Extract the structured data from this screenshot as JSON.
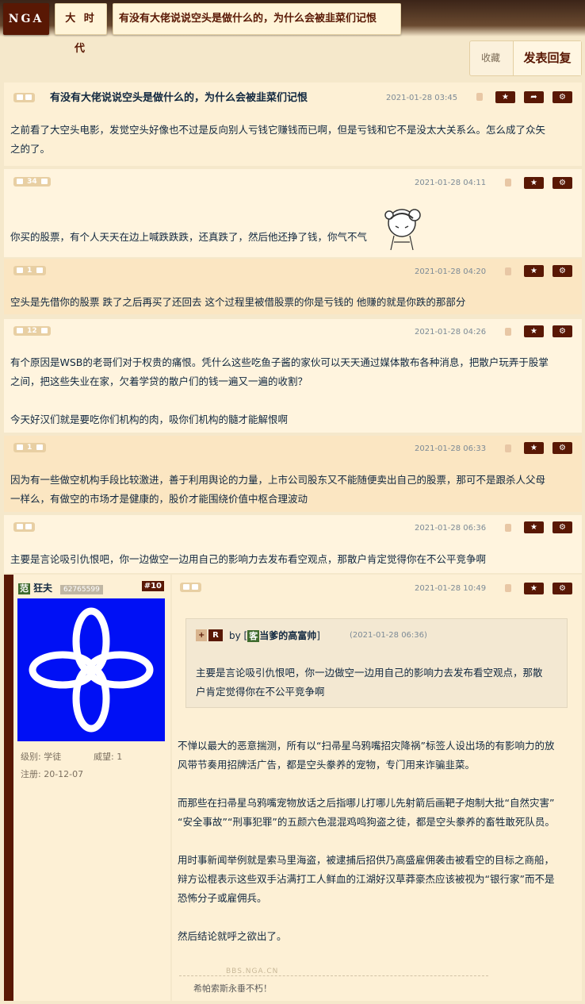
{
  "header": {
    "logo": "NGA",
    "forum": "大 时 代",
    "topic": "有没有大佬说说空头是做什么的，为什么会被韭菜们记恨"
  },
  "actions": {
    "favorite": "收藏",
    "reply": "发表回复"
  },
  "posts": [
    {
      "title": "有没有大佬说说空头是做什么的，为什么会被韭菜们记恨",
      "votes": "",
      "time": "2021-01-28 03:45",
      "lines": [
        "之前看了大空头电影，发觉空头好像也不过是反向别人亏钱它赚钱而已啊，但是亏钱和它不是没太大关系么。怎么成了众矢",
        "之的了。"
      ]
    },
    {
      "votes": "34",
      "time": "2021-01-28 04:11",
      "lines": [
        "你买的股票，有个人天天在边上喊跌跌跌，还真跌了，然后他还挣了钱，你气不气"
      ]
    },
    {
      "votes": "1",
      "time": "2021-01-28 04:20",
      "lines": [
        "空头是先借你的股票 跌了之后再买了还回去 这个过程里被借股票的你是亏钱的 他赚的就是你跌的那部分"
      ]
    },
    {
      "votes": "12",
      "time": "2021-01-28 04:26",
      "lines": [
        "有个原因是WSB的老哥们对于权贵的痛恨。凭什么这些吃鱼子酱的家伙可以天天通过媒体散布各种消息，把散户玩弄于股掌",
        "之间，把这些失业在家，欠着学贷的散户们的钱一遍又一遍的收割？",
        "",
        "今天好汉们就是要吃你们机构的肉，吸你们机构的髓才能解恨啊"
      ]
    },
    {
      "votes": "1",
      "time": "2021-01-28 06:33",
      "lines": [
        "因为有一些做空机构手段比较激进，善于利用舆论的力量，上市公司股东又不能随便卖出自己的股票，那可不是跟杀人父母",
        "一样么，有做空的市场才是健康的，股价才能围绕价值中枢合理波动"
      ]
    },
    {
      "votes": "",
      "time": "2021-01-28 06:36",
      "lines": [
        "主要是言论吸引仇恨吧，你一边做空一边用自己的影响力去发布看空观点，那散户肯定觉得你在不公平竞争啊"
      ]
    }
  ],
  "floor10": {
    "user": {
      "badge": "范",
      "name": "狂夫",
      "uid": "62765599",
      "floor": "#10",
      "level_label": "级别:",
      "level": "学徒",
      "prestige_label": "威望:",
      "prestige": "1",
      "reg_label": "注册:",
      "reg": "20-12-07"
    },
    "time": "2021-01-28 10:49",
    "quote": {
      "btn1": "+",
      "btn2": "R",
      "by": "by",
      "guest": "客",
      "name": "当爹的高富帅",
      "time": "(2021-01-28 06:36)",
      "lines": [
        "主要是言论吸引仇恨吧，你一边做空一边用自己的影响力去发布看空观点，那散",
        "户肯定觉得你在不公平竞争啊"
      ]
    },
    "lines": [
      "不惮以最大的恶意揣测，所有以“扫帚星乌鸦嘴招灾降祸”标签人设出场的有影响力的放",
      "风带节奏用招牌活广告，都是空头豢养的宠物，专门用来诈骗韭菜。",
      "",
      "而那些在扫帚星乌鸦嘴宠物放话之后指哪儿打哪儿先射箭后画靶子炮制大批“自然灾害”",
      "“安全事故”“刑事犯罪”的五颜六色混混鸡鸣狗盗之徒，都是空头豢养的畜牲敢死队员。",
      "",
      "用时事新闻举例就是索马里海盗，被逮捕后招供乃高盛雇佣袭击被看空的目标之商船，",
      "辩方讼棍表示这些双手沾满打工人鲜血的江湖好汉草莽豪杰应该被视为“银行家”而不是",
      "恐怖分子或雇佣兵。",
      "",
      "然后结论就呼之欲出了。"
    ],
    "watermark": "BBS.NGA.CN",
    "signature": "希帕索斯永垂不朽！"
  },
  "colors": {
    "brand": "#591804",
    "bg": "#f5e8cb",
    "post_a": "#fdf0d5",
    "post_b": "#fbe6c2",
    "avatar_bg": "#0010f5"
  }
}
